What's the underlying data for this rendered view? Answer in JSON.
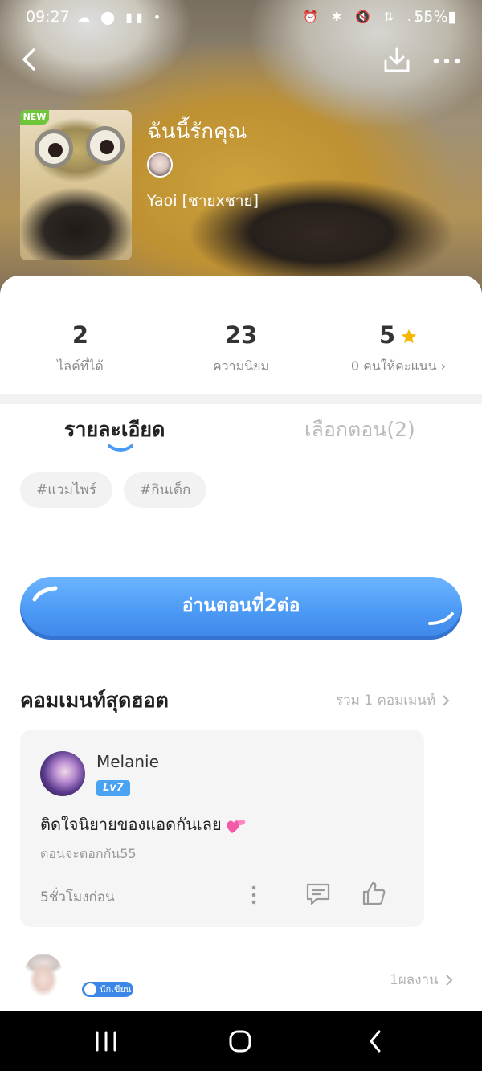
{
  "status_bar": {
    "time": "09:27",
    "left_icons": "☁ ⬤ ▮▮ •",
    "right_icons": "⏰ ✱ 🔇 ⇅ .ıl",
    "battery": "55%▮"
  },
  "story": {
    "new_badge": "NEW",
    "title": "ฉันนี้รักคุณ",
    "genre": "Yaoi [ชายxชาย]"
  },
  "stats": [
    {
      "value": "2",
      "label": "ไลค์ที่ได้"
    },
    {
      "value": "23",
      "label": "ความนิยม"
    },
    {
      "value": "5",
      "label": "0 คนให้คะแนน ›",
      "rating_stars": 1
    }
  ],
  "tabs": {
    "details": "รายละเอียด",
    "episodes": "เลือกตอน(2)"
  },
  "tags": [
    "#แวมไพร์",
    "#กินเด็ก"
  ],
  "read_button": "อ่านตอนที่2ต่อ",
  "hot_comments": {
    "title": "คอมเมนท์สุดฮอต",
    "total_link": "รวม 1 คอมเมนท์",
    "items": [
      {
        "name": "Melanie",
        "level": "Lv7",
        "text": "ติดใจนิยายของแอดกันเลย",
        "reply": "ตอนจะตอกกัน55",
        "time": "5ชั่วโมงก่อน"
      }
    ]
  },
  "writer": {
    "badge": "นักเขียน",
    "works_link": "1ผลงาน"
  },
  "colors": {
    "accent": "#4a9bf5",
    "new_badge": "#6ec53a",
    "star": "#f5b800",
    "level_badge": "#4aa3f2"
  }
}
